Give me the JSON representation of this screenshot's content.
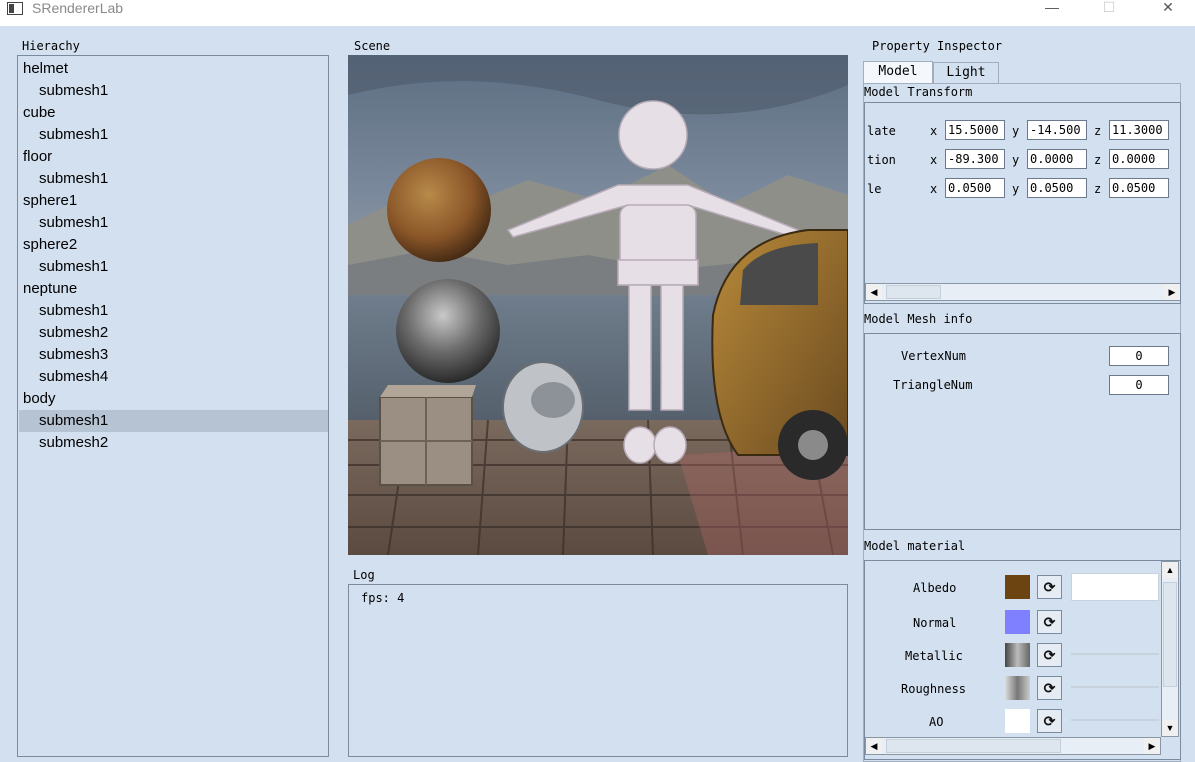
{
  "window": {
    "title": "SRendererLab",
    "min": "—",
    "max": "☐",
    "close": "✕"
  },
  "hierarchy": {
    "label": "Hierachy",
    "items": [
      {
        "text": "helmet",
        "level": 0
      },
      {
        "text": "submesh1",
        "level": 1
      },
      {
        "text": "cube",
        "level": 0
      },
      {
        "text": "submesh1",
        "level": 1
      },
      {
        "text": "floor",
        "level": 0
      },
      {
        "text": "submesh1",
        "level": 1
      },
      {
        "text": "sphere1",
        "level": 0
      },
      {
        "text": "submesh1",
        "level": 1
      },
      {
        "text": "sphere2",
        "level": 0
      },
      {
        "text": "submesh1",
        "level": 1
      },
      {
        "text": "neptune",
        "level": 0
      },
      {
        "text": "submesh1",
        "level": 1
      },
      {
        "text": "submesh2",
        "level": 1
      },
      {
        "text": "submesh3",
        "level": 1
      },
      {
        "text": "submesh4",
        "level": 1
      },
      {
        "text": "body",
        "level": 0
      },
      {
        "text": "submesh1",
        "level": 1,
        "selected": true
      },
      {
        "text": "submesh2",
        "level": 1
      }
    ]
  },
  "scene": {
    "label": "Scene"
  },
  "log": {
    "label": "Log",
    "lines": [
      "fps: 4"
    ]
  },
  "inspector": {
    "label": "Property Inspector",
    "tabs": [
      {
        "label": "Model",
        "active": true
      },
      {
        "label": "Light",
        "active": false
      }
    ],
    "transform": {
      "title": "Model Transform",
      "rows": [
        {
          "label": "late",
          "x": "15.5000",
          "y": "-14.500",
          "z": "11.3000"
        },
        {
          "label": "tion",
          "x": "-89.300",
          "y": "0.0000",
          "z": "0.0000"
        },
        {
          "label": "le",
          "x": "0.0500",
          "y": "0.0500",
          "z": "0.0500"
        }
      ],
      "axis_x": "x",
      "axis_y": "y",
      "axis_z": "z"
    },
    "mesh_info": {
      "title": "Model Mesh info",
      "vertex_label": "VertexNum",
      "vertex_value": "0",
      "triangle_label": "TriangleNum",
      "triangle_value": "0"
    },
    "material": {
      "title": "Model material",
      "rows": [
        {
          "label": "Albedo",
          "swatch": "#6b4412"
        },
        {
          "label": "Normal",
          "swatch": "#7f80ff"
        },
        {
          "label": "Metallic",
          "swatch": "#8c8c8c"
        },
        {
          "label": "Roughness",
          "swatch": "#a0a0a0"
        },
        {
          "label": "AO",
          "swatch": "#ffffff"
        }
      ],
      "reload_glyph": "⟳"
    }
  },
  "colors": {
    "bg": "#d3e0f0",
    "selected_row": "#b6c3d3"
  }
}
